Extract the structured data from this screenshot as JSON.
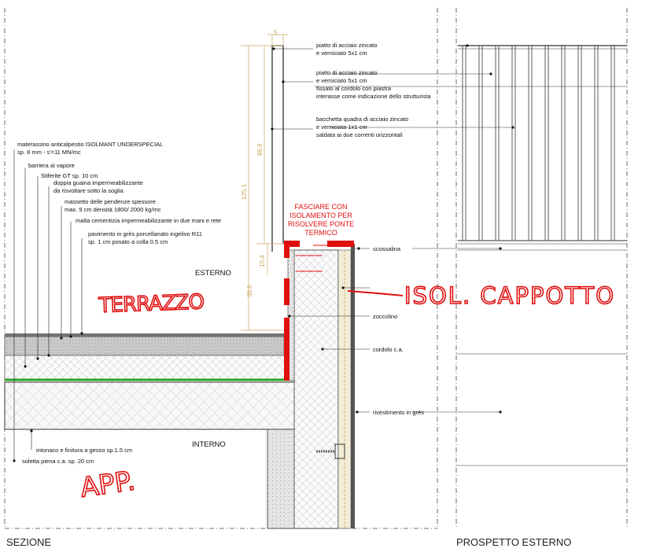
{
  "sections": {
    "left_title": "SEZIONE",
    "right_title": "PROSPETTO ESTERNO"
  },
  "zones": {
    "exterior": "ESTERNO",
    "interior": "INTERNO"
  },
  "layers": [
    {
      "line1": "materassino anticalpestio ISOLMANT UNDERSPECIAL",
      "line2": "sp. 8 mm - s'=11 MN/mc"
    },
    {
      "line1": "barriera al vapore",
      "line2": ""
    },
    {
      "line1": "Stiferite GT sp. 10 cm",
      "line2": ""
    },
    {
      "line1": "doppia guaina impermeabilizzante",
      "line2": "da risvoltare sotto la soglia"
    },
    {
      "line1": "massetto delle pendenze spessore",
      "line2": "max. 9 cm densità 1800/ 2000 kg/mc"
    },
    {
      "line1": "malta cementizia impermeabilizzante in due mani e rete",
      "line2": ""
    },
    {
      "line1": "pavimento in grès porcellanato ingelivo R11",
      "line2": "sp. 1 cm posato a colla 0.5 cm"
    }
  ],
  "railing_notes": [
    {
      "line1": "piatto di acciaio zincato",
      "line2": "e verniciato 5x1 cm",
      "line3": "",
      "line4": ""
    },
    {
      "line1": "piatto di acciaio zincato",
      "line2": "e verniciato 5x1 cm",
      "line3": "fissato al cordolo con piastra",
      "line4": "interasse come indicazione dello strutturista"
    },
    {
      "line1": "bacchetta quadra di acciaio zincato",
      "line2": "e verniciata 1x1 cm",
      "line3": "saldata ai due correnti orizzontali",
      "line4": ""
    }
  ],
  "right_notes": {
    "scossalina": "scossalina",
    "zoccolino": "zoccolino",
    "cordolo": "cordolo c.a.",
    "rivestimento": "rivestimento in grès"
  },
  "bottom_notes": {
    "intonaco": "intonaco e finitura a gesso sp.1.5 cm",
    "soletta": "soletta piena c.a. sp. 20 cm"
  },
  "dimensions": {
    "top": "5",
    "d125": "125.1",
    "d86": "86.8",
    "d38": "38.6",
    "d10": "10.4"
  },
  "red_note": {
    "line1": "FASCIARE CON",
    "line2": "ISOLAMENTO PER",
    "line3": "RISOLVERE PONTE",
    "line4": "TERMICO"
  },
  "handwritten": {
    "terrazzo": "TERRAZZO",
    "isol": "ISOL. CAPPOTTO",
    "app": "APP."
  },
  "colors": {
    "annotation_red": "#e01010",
    "dimension": "#c8a85a",
    "membrane_green": "#2aa52a"
  }
}
